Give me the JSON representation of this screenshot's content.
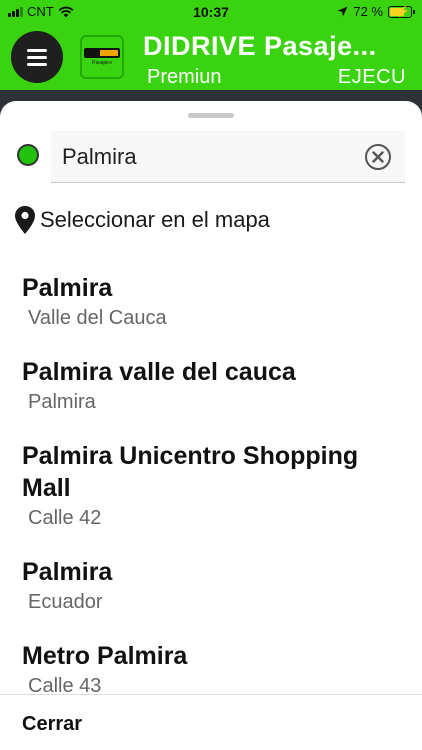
{
  "status_bar": {
    "carrier": "CNT",
    "time": "10:37",
    "battery_text": "72 %",
    "battery_level": 0.72,
    "icons": [
      "signal-icon",
      "wifi-icon",
      "location-arrow-icon",
      "battery-icon"
    ]
  },
  "header": {
    "title": "DIDRIVE Pasaje...",
    "subtitle_left": "Premiun",
    "subtitle_right": "EJECU",
    "background_color": "#39d40f",
    "logo_text": "Pasajero"
  },
  "search": {
    "value": "Palmira",
    "placeholder": ""
  },
  "map_option": {
    "label": "Seleccionar en el mapa"
  },
  "results": [
    {
      "title": "Palmira",
      "subtitle": "Valle del Cauca"
    },
    {
      "title": "Palmira valle del cauca",
      "subtitle": "Palmira"
    },
    {
      "title": "Palmira Unicentro Shopping Mall",
      "subtitle": "Calle 42"
    },
    {
      "title": "Palmira",
      "subtitle": "Ecuador"
    },
    {
      "title": "Metro Palmira",
      "subtitle": "Calle 43"
    }
  ],
  "footer": {
    "close_label": "Cerrar"
  }
}
